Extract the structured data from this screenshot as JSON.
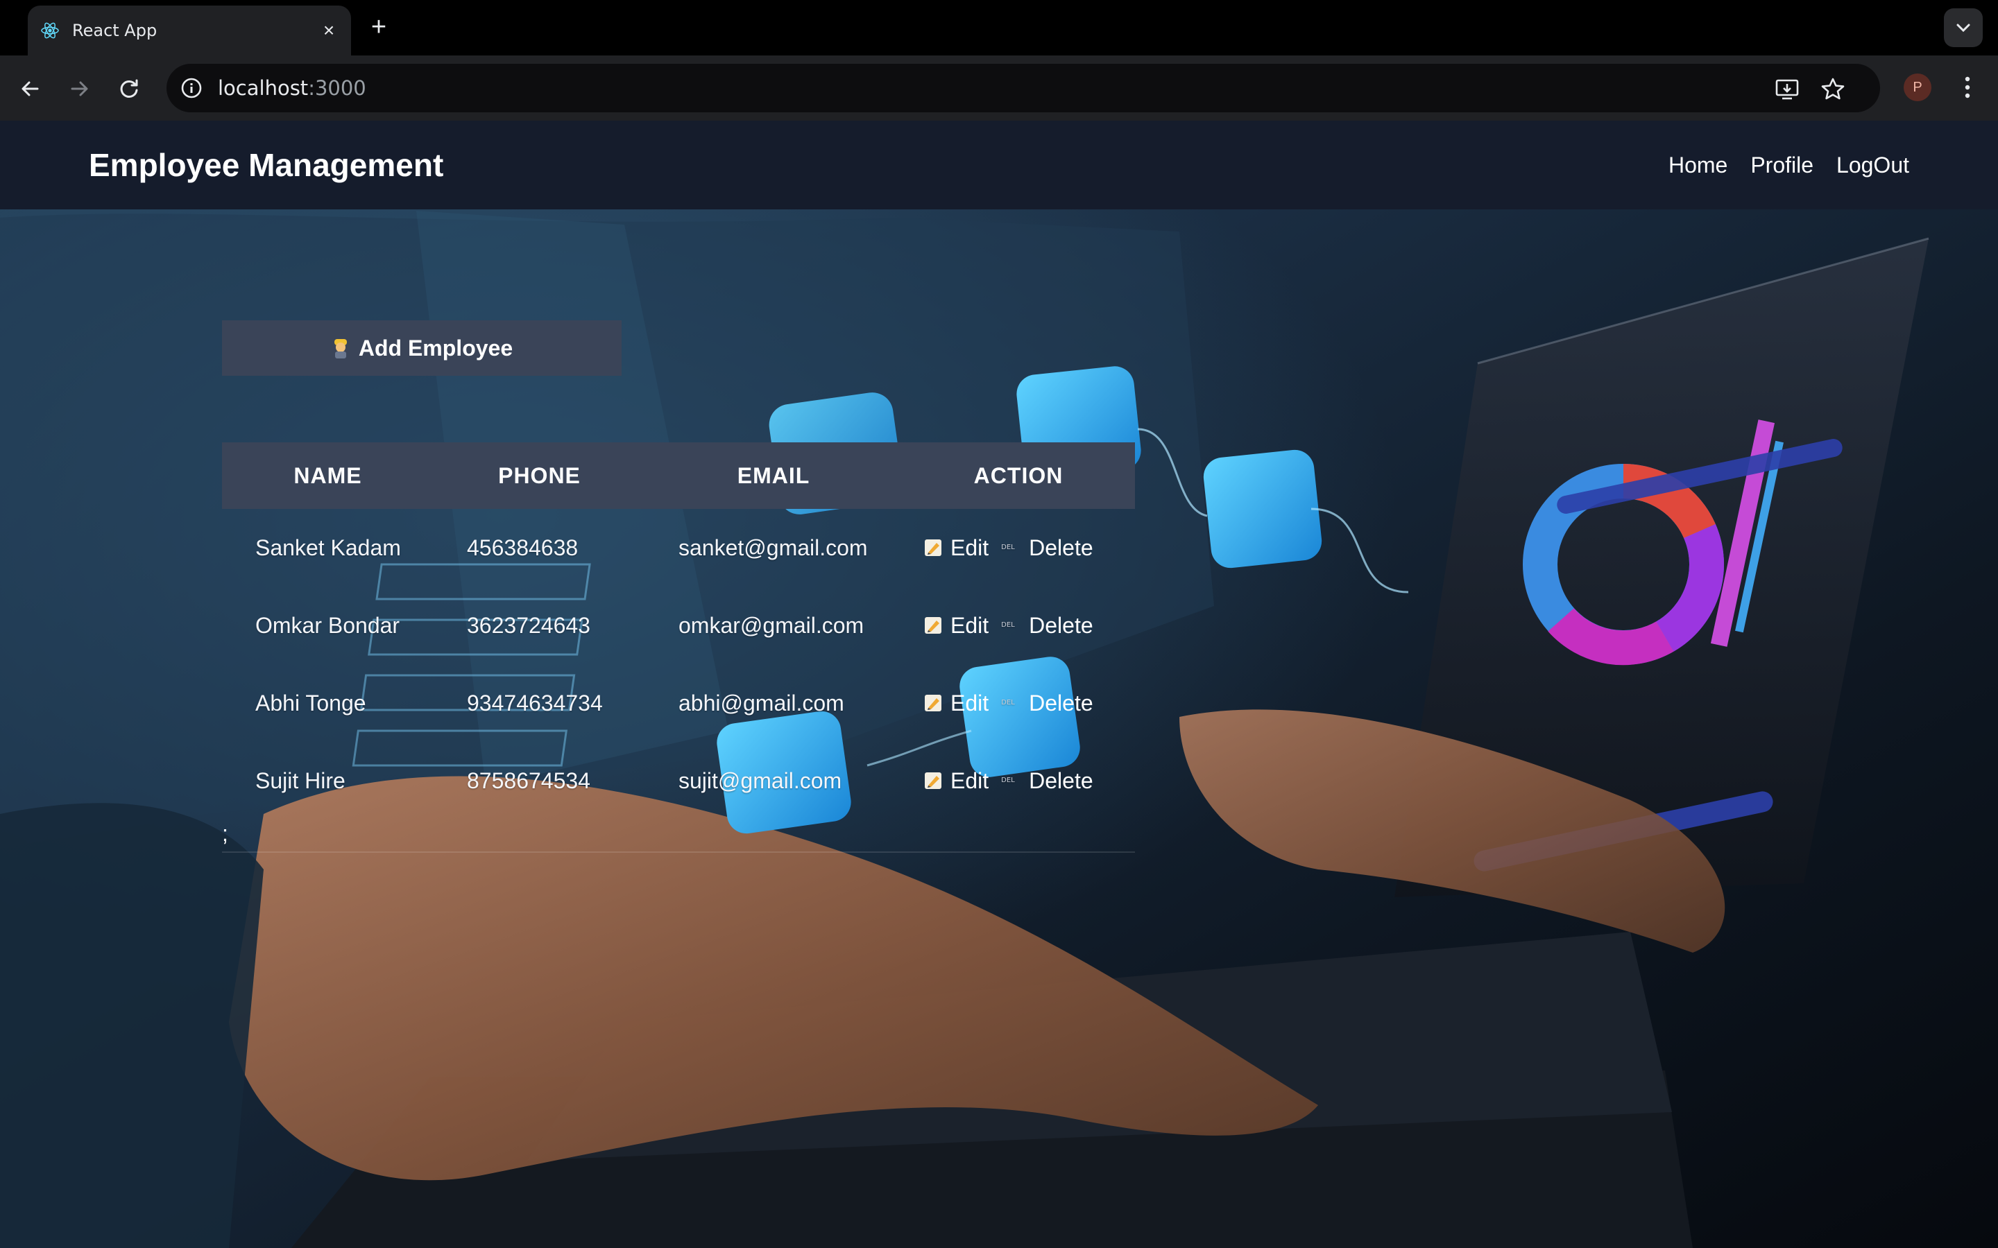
{
  "browser": {
    "tab_title": "React App",
    "url_host": "localhost",
    "url_port": ":3000",
    "profile_initial": "P"
  },
  "navbar": {
    "brand": "Employee Management",
    "links": [
      "Home",
      "Profile",
      "LogOut"
    ]
  },
  "add_button": {
    "label": "Add Employee"
  },
  "table": {
    "headers": [
      "NAME",
      "PHONE",
      "EMAIL",
      "ACTION"
    ],
    "rows": [
      {
        "name": "Sanket Kadam",
        "phone": "456384638",
        "email": "sanket@gmail.com"
      },
      {
        "name": "Omkar Bondar",
        "phone": "3623724643",
        "email": "omkar@gmail.com"
      },
      {
        "name": "Abhi Tonge",
        "phone": "93474634734",
        "email": "abhi@gmail.com"
      },
      {
        "name": "Sujit Hire",
        "phone": "8758674534",
        "email": "sujit@gmail.com"
      }
    ],
    "edit_label": "Edit",
    "delete_label": "Delete",
    "delete_icon_text": "DEL"
  },
  "stray_text": ";",
  "colors": {
    "navbar_bg": "#151c2c",
    "header_bg": "#3a4458",
    "button_bg": "#3a4458"
  },
  "icons": [
    "react-icon",
    "close-icon",
    "plus-icon",
    "back-icon",
    "forward-icon",
    "reload-icon",
    "info-icon",
    "install-icon",
    "star-icon",
    "kebab-menu-icon",
    "chevron-down-icon",
    "worker-emoji-icon",
    "pencil-icon",
    "delete-icon"
  ]
}
